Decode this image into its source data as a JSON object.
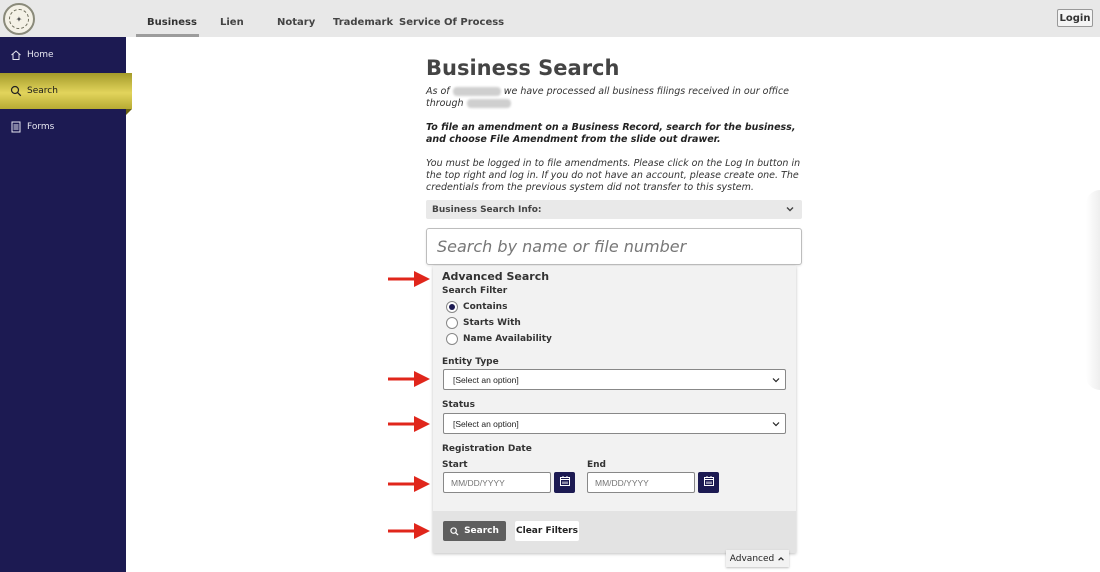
{
  "header": {
    "tabs": [
      {
        "label": "Business",
        "active": true
      },
      {
        "label": "Lien",
        "active": false
      },
      {
        "label": "Notary",
        "active": false
      },
      {
        "label": "Trademark",
        "active": false
      },
      {
        "label": "Service Of Process",
        "active": false
      }
    ],
    "login_label": "Login"
  },
  "sidebar": {
    "items": [
      {
        "label": "Home",
        "icon": "home-icon"
      },
      {
        "label": "Search",
        "icon": "search-icon",
        "active": true
      },
      {
        "label": "Forms",
        "icon": "forms-icon"
      }
    ]
  },
  "main": {
    "title": "Business Search",
    "intro_prefix": "As of",
    "intro_middle": "we have processed all business filings received in our office",
    "intro_through": "through",
    "amendment_note": "To file an amendment on a Business Record, search for the business, and choose File Amendment from the slide out drawer.",
    "login_note": "You must be logged in to file amendments. Please click on the Log In button in the top right and log in. If you do not have an account, please create one. The credentials from the previous system did not transfer to this system.",
    "info_bar_label": "Business Search Info:",
    "search_placeholder": "Search by name or file number"
  },
  "advanced": {
    "title": "Advanced Search",
    "filter_label": "Search Filter",
    "filter_options": [
      {
        "label": "Contains",
        "checked": true
      },
      {
        "label": "Starts With",
        "checked": false
      },
      {
        "label": "Name Availability",
        "checked": false
      }
    ],
    "entity_type_label": "Entity Type",
    "entity_type_value": "[Select an option]",
    "status_label": "Status",
    "status_value": "[Select an option]",
    "registration_date_label": "Registration Date",
    "start_label": "Start",
    "end_label": "End",
    "date_placeholder": "MM/DD/YYYY",
    "search_button": "Search",
    "clear_button": "Clear Filters",
    "toggle_label": "Advanced"
  },
  "colors": {
    "sidebar_bg": "#1c1a52",
    "active_gold": "#e2d45c",
    "annotation_arrow": "#e0261b"
  }
}
